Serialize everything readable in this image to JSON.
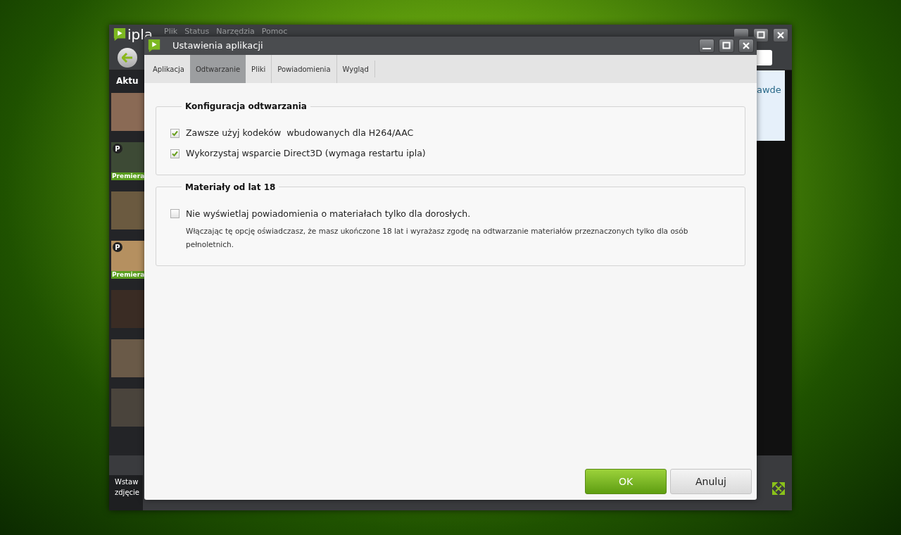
{
  "app": {
    "logo": "ipla",
    "menu": [
      "Plik",
      "Status",
      "Narzędzia",
      "Pomoc"
    ],
    "sidebar_title": "Aktu",
    "thumbnails": [
      {
        "premiere": false
      },
      {
        "premiere": true,
        "badge": "P",
        "label": "Premiera"
      },
      {
        "premiere": false
      },
      {
        "premiere": true,
        "badge": "P",
        "label": "Premiera"
      },
      {
        "premiere": false
      },
      {
        "premiere": false
      },
      {
        "premiere": false
      }
    ],
    "banner_text": "awde",
    "insert_photo": "Wstaw zdjęcie"
  },
  "dialog": {
    "title": "Ustawienia aplikacji",
    "tabs": [
      {
        "label": "Aplikacja",
        "selected": false
      },
      {
        "label": "Odtwarzanie",
        "selected": true
      },
      {
        "label": "Pliki",
        "selected": false
      },
      {
        "label": "Powiadomienia",
        "selected": false
      },
      {
        "label": "Wygląd",
        "selected": false
      }
    ],
    "sections": [
      {
        "title": "Konfiguracja odtwarzania",
        "options": [
          {
            "label": "Zawsze użyj kodeków  wbudowanych dla H264/AAC",
            "checked": true
          },
          {
            "label": "Wykorzystaj wsparcie Direct3D (wymaga restartu ipla)",
            "checked": true
          }
        ]
      },
      {
        "title": "Materiały od lat 18",
        "options": [
          {
            "label": "Nie wyświetlaj powiadomienia o materiałach tylko dla dorosłych.",
            "checked": false,
            "note": "Włączając tę opcję oświadczasz, że masz ukończone 18 lat i wyrażasz zgodę na odtwarzanie materiałów przeznaczonych tylko dla osób pełnoletnich."
          }
        ]
      }
    ],
    "buttons": [
      {
        "label": "OK",
        "kind": "primary"
      },
      {
        "label": "Anuluj",
        "kind": "secondary"
      }
    ]
  }
}
